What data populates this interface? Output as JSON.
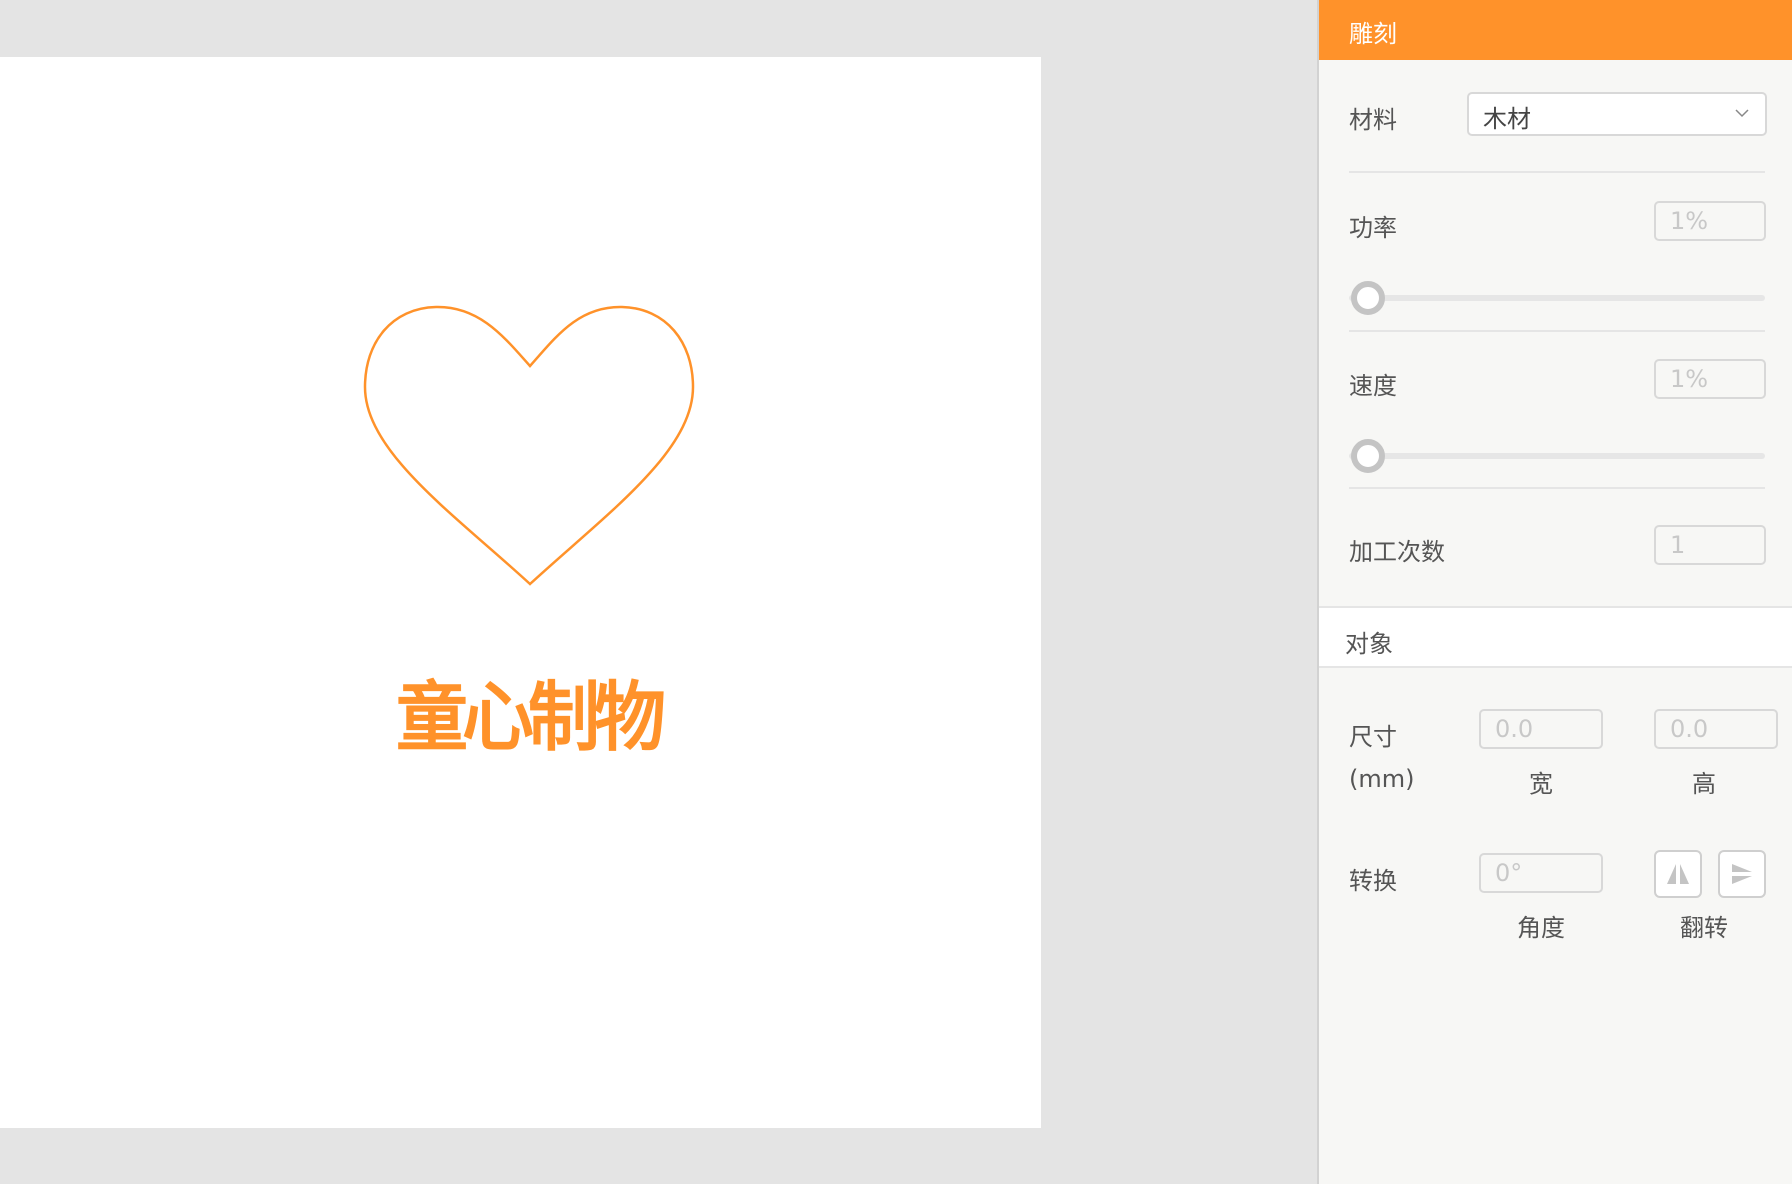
{
  "canvas": {
    "text": "童心制物",
    "shape_icon": "heart-outline",
    "accent_color": "#ff922a"
  },
  "panel": {
    "title": "雕刻",
    "material": {
      "label": "材料",
      "value": "木材"
    },
    "power": {
      "label": "功率",
      "value": "1%",
      "slider_fraction": 0.0
    },
    "speed": {
      "label": "速度",
      "value": "1%",
      "slider_fraction": 0.0
    },
    "passes": {
      "label": "加工次数",
      "value": "1"
    },
    "object_section": "对象",
    "size": {
      "label": "尺寸",
      "unit": "(mm)",
      "width_value": "0.0",
      "width_label": "宽",
      "height_value": "0.0",
      "height_label": "高"
    },
    "transform": {
      "label": "转换",
      "angle_value": "0°",
      "angle_label": "角度",
      "flip_label": "翻转",
      "flip_horizontal_icon": "flip-horizontal-icon",
      "flip_vertical_icon": "flip-vertical-icon"
    }
  }
}
